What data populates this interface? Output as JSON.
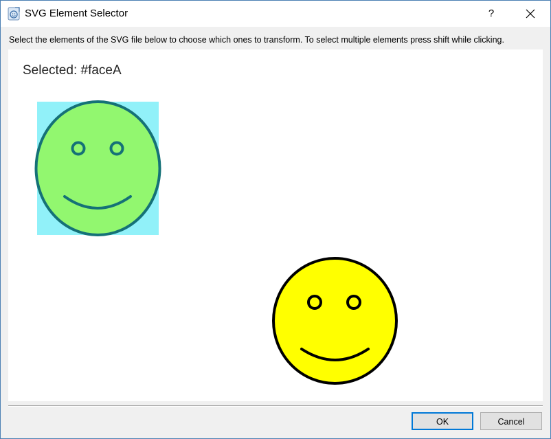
{
  "window": {
    "title": "SVG Element Selector",
    "help_label": "?",
    "icon": "svg-app-icon",
    "close_icon": "close-icon"
  },
  "instructions": "Select the elements of the SVG file below to choose which ones to transform.  To select multiple elements press shift while clicking.",
  "canvas": {
    "selected_text": "Selected: #faceA",
    "elements": [
      {
        "id": "faceA",
        "selected": true,
        "fill": "#92f76f",
        "stroke": "#157177",
        "highlight": "#91f1f9"
      },
      {
        "id": "faceB",
        "selected": false,
        "fill": "#ffff00",
        "stroke": "#000000"
      }
    ]
  },
  "buttons": {
    "ok": "OK",
    "cancel": "Cancel"
  },
  "colors": {
    "accent": "#0078d7",
    "window_border": "#4a7fb3",
    "dialog_bg": "#f0f0f0"
  }
}
